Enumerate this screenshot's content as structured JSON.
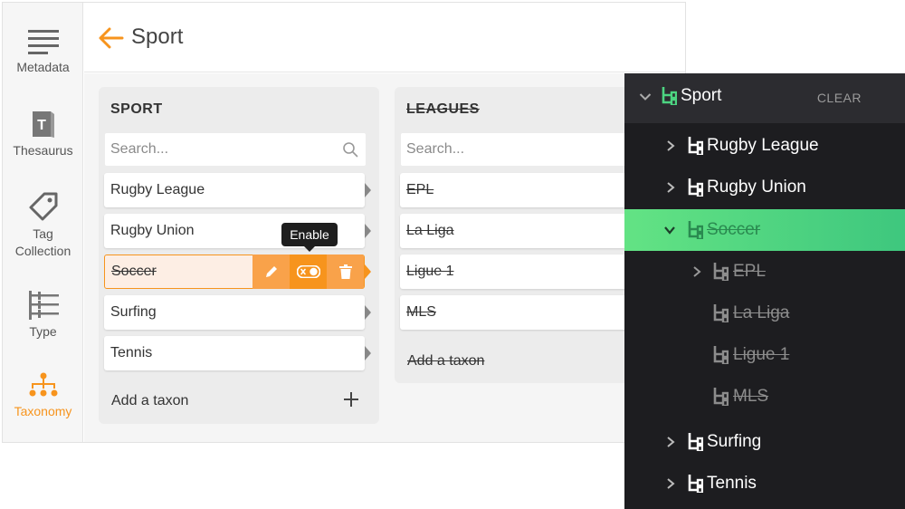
{
  "nav": {
    "items": [
      {
        "label": "Metadata",
        "icon": "lines-icon"
      },
      {
        "label": "Thesaurus",
        "icon": "book-icon"
      },
      {
        "label": "Tag Collection",
        "line1": "Tag",
        "line2": "Collection",
        "icon": "tag-icon"
      },
      {
        "label": "Type",
        "icon": "type-icon"
      },
      {
        "label": "Taxonomy",
        "icon": "taxonomy-icon",
        "active": true
      }
    ]
  },
  "header": {
    "title": "Sport"
  },
  "sport_column": {
    "title": "SPORT",
    "search_placeholder": "Search...",
    "rows": [
      "Rugby League",
      "Rugby Union",
      "Soccer",
      "Surfing",
      "Tennis"
    ],
    "selected": "Soccer",
    "add_label": "Add a taxon"
  },
  "tooltip": {
    "text": "Enable"
  },
  "leagues_column": {
    "title": "LEAGUES",
    "search_placeholder": "Search...",
    "rows": [
      "EPL",
      "La Liga",
      "Ligue 1",
      "MLS"
    ],
    "add_label": "Add a taxon"
  },
  "tree": {
    "root": "Sport",
    "clear_label": "CLEAR",
    "items": [
      "Rugby League",
      "Rugby Union",
      "Soccer",
      "EPL",
      "La Liga",
      "Ligue 1",
      "MLS",
      "Surfing",
      "Tennis"
    ]
  },
  "colors": {
    "accent": "#f7941d",
    "tree_bg": "#1d1d20",
    "tree_active": "#4cd481",
    "tree_node_green": "#4cd481"
  }
}
